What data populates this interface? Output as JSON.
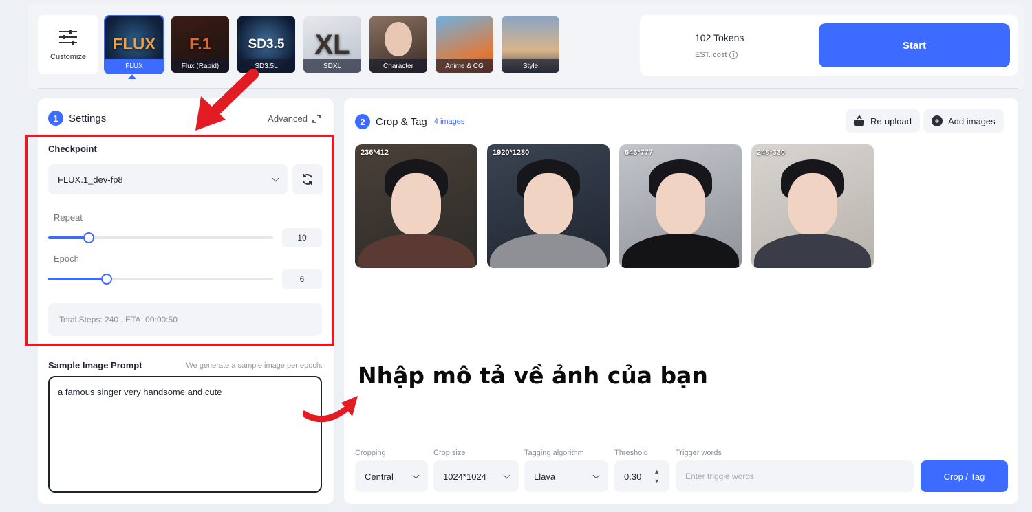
{
  "models": {
    "customize_label": "Customize",
    "items": [
      {
        "label": "FLUX",
        "thumb_text": "FLUX"
      },
      {
        "label": "Flux (Rapid)",
        "thumb_text": "F.1"
      },
      {
        "label": "SD3.5L",
        "thumb_text": "SD3.5"
      },
      {
        "label": "SDXL",
        "thumb_text": "XL"
      },
      {
        "label": "Character",
        "thumb_text": ""
      },
      {
        "label": "Anime & CG",
        "thumb_text": ""
      },
      {
        "label": "Style",
        "thumb_text": ""
      }
    ]
  },
  "cost": {
    "tokens": "102 Tokens",
    "est_label": "EST. cost",
    "start_label": "Start"
  },
  "settings": {
    "step": "1",
    "title": "Settings",
    "advanced_label": "Advanced",
    "checkpoint_label": "Checkpoint",
    "checkpoint_value": "FLUX.1_dev-fp8",
    "repeat_label": "Repeat",
    "repeat_value": "10",
    "repeat_fraction": 0.18,
    "epoch_label": "Epoch",
    "epoch_value": "6",
    "epoch_fraction": 0.26,
    "steps_text": "Total Steps: 240 ,  ETA: 00:00:50",
    "prompt_label": "Sample Image Prompt",
    "prompt_hint": "We generate a sample image per epoch.",
    "prompt_value": "a famous singer very handsome and cute"
  },
  "crop": {
    "step": "2",
    "title": "Crop & Tag",
    "count": "4 images",
    "reupload_label": "Re-upload",
    "add_label": "Add images",
    "images": [
      {
        "dim": "236*412"
      },
      {
        "dim": "1920*1280"
      },
      {
        "dim": "643*777"
      },
      {
        "dim": "248*330"
      }
    ],
    "annotation": "Nhập mô tả về ảnh của bạn",
    "cropping_label": "Cropping",
    "cropping_value": "Central",
    "crop_size_label": "Crop size",
    "crop_size_value": "1024*1024",
    "tagging_label": "Tagging algorithm",
    "tagging_value": "Llava",
    "threshold_label": "Threshold",
    "threshold_value": "0.30",
    "trigger_label": "Trigger words",
    "trigger_placeholder": "Enter triggle words",
    "croptag_label": "Crop / Tag"
  }
}
